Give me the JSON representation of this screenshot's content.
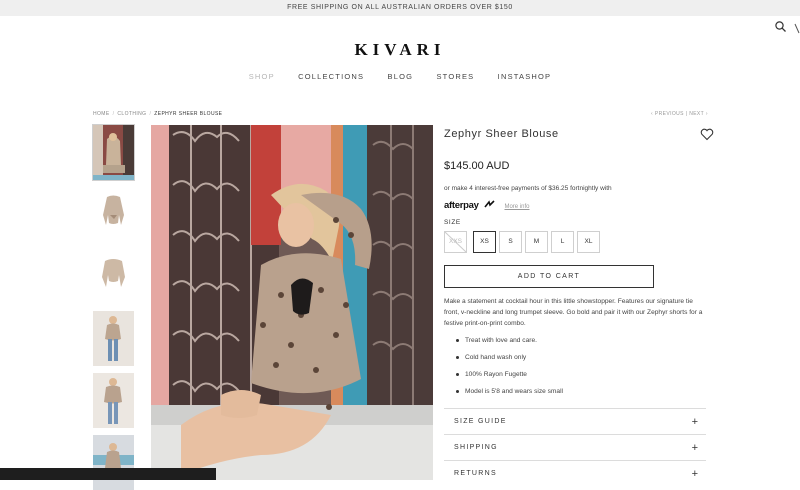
{
  "promo": {
    "text": "FREE SHIPPING ON ALL AUSTRALIAN ORDERS OVER $150"
  },
  "brand": {
    "logo": "KIVARI"
  },
  "header": {
    "search_icon": "search-icon"
  },
  "nav": {
    "items": [
      {
        "label": "SHOP",
        "active": true
      },
      {
        "label": "COLLECTIONS",
        "active": false
      },
      {
        "label": "BLOG",
        "active": false
      },
      {
        "label": "STORES",
        "active": false
      },
      {
        "label": "INSTASHOP",
        "active": false
      }
    ]
  },
  "breadcrumb": {
    "home": "HOME",
    "category": "CLOTHING",
    "current": "ZEPHYR SHEER BLOUSE"
  },
  "pager": {
    "previous": "PREVIOUS",
    "next": "NEXT"
  },
  "product": {
    "title": "Zephyr Sheer Blouse",
    "price": "$145.00 AUD",
    "afterpay_text": "or make 4 interest-free payments of $36.25 fortnightly with",
    "afterpay_logo": "afterpay",
    "afterpay_more": "More info",
    "size_label": "SIZE",
    "sizes": [
      {
        "label": "XXS",
        "available": false,
        "selected": false
      },
      {
        "label": "XS",
        "available": true,
        "selected": true
      },
      {
        "label": "S",
        "available": true,
        "selected": false
      },
      {
        "label": "M",
        "available": true,
        "selected": false
      },
      {
        "label": "L",
        "available": true,
        "selected": false
      },
      {
        "label": "XL",
        "available": true,
        "selected": false
      }
    ],
    "add_to_cart": "ADD TO CART",
    "description": "Make a statement at cocktail hour in this little showstopper. Features our signature tie front, v-neckline and long trumpet sleeve. Go bold and pair it with our Zephyr shorts for a festive print-on-print combo.",
    "details": [
      "Treat with love and care.",
      "Cold hand wash only",
      "100% Rayon Fugette",
      "Model is 5'8 and wears size small"
    ],
    "accordion": [
      {
        "label": "SIZE GUIDE"
      },
      {
        "label": "SHIPPING"
      },
      {
        "label": "RETURNS"
      }
    ],
    "accordion_icon": "+"
  },
  "colors": {
    "accent": "#333333",
    "promo_bg": "#efefef",
    "muted": "#b5b5b5"
  }
}
